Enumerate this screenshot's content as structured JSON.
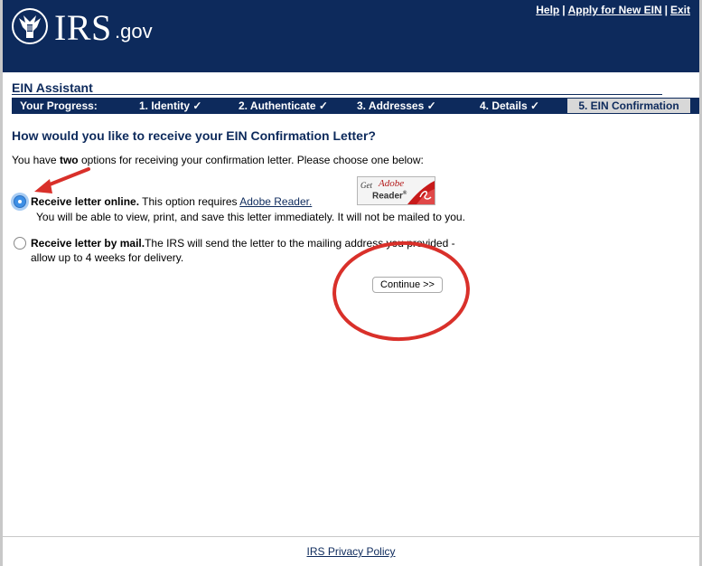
{
  "header": {
    "logo_text": "IRS",
    "logo_domain": ".gov",
    "links": [
      {
        "label": "Help"
      },
      {
        "label": "Apply for New EIN"
      },
      {
        "label": "Exit"
      }
    ],
    "separator": "|"
  },
  "assistant": {
    "title": "EIN Assistant"
  },
  "progress": {
    "label": "Your Progress:",
    "steps": [
      {
        "label": "1. Identity ✓"
      },
      {
        "label": "2. Authenticate ✓"
      },
      {
        "label": "3. Addresses ✓"
      },
      {
        "label": "4. Details ✓"
      },
      {
        "label": "5. EIN Confirmation"
      }
    ]
  },
  "main": {
    "question": "How would you like to receive your EIN Confirmation Letter?",
    "intro_before": "You have ",
    "intro_bold": "two",
    "intro_after": " options for receiving your confirmation letter. Please choose one below:",
    "options": [
      {
        "title": "Receive letter online.",
        "text": " This option requires ",
        "link": "Adobe Reader.",
        "detail": "You will be able to view, print, and save this letter immediately. It will not be mailed to you.",
        "selected": true
      },
      {
        "title": "Receive letter by mail.",
        "text": "The IRS will send the letter to the mailing address you provided -",
        "detail": "allow up to 4 weeks for delivery.",
        "selected": false
      }
    ],
    "adobe_badge": {
      "get": "Get",
      "brand": "Adobe",
      "product": "Reader",
      "reg": "®"
    },
    "continue_label": "Continue >>"
  },
  "footer": {
    "privacy_link": "IRS Privacy Policy"
  },
  "colors": {
    "navy": "#0d2a5c",
    "annotation_red": "#d9302a",
    "radio_selected": "#3d8fe6"
  }
}
